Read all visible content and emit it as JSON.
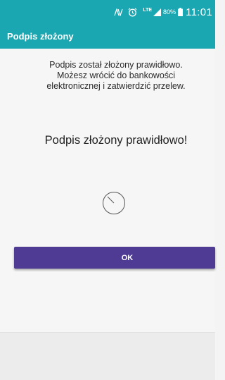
{
  "status_bar": {
    "network_type": "LTE",
    "battery_percent": "80%",
    "time": "11:01",
    "background_color": "#1aa7b1",
    "icons": [
      "nfc-icon",
      "alarm-icon",
      "lte-icon",
      "signal-icon",
      "battery-icon"
    ]
  },
  "app_bar": {
    "title": "Podpis złożony"
  },
  "content": {
    "message_lines": [
      "Podpis został złożony prawidłowo.",
      "Możesz wrócić do bankowości",
      "elektronicznej i zatwierdzić przelew."
    ],
    "headline": "Podpis złożony prawidłowo!",
    "spinner_icon": "spinner-icon"
  },
  "ok_button": {
    "label": "OK",
    "color": "#4f3b93"
  }
}
